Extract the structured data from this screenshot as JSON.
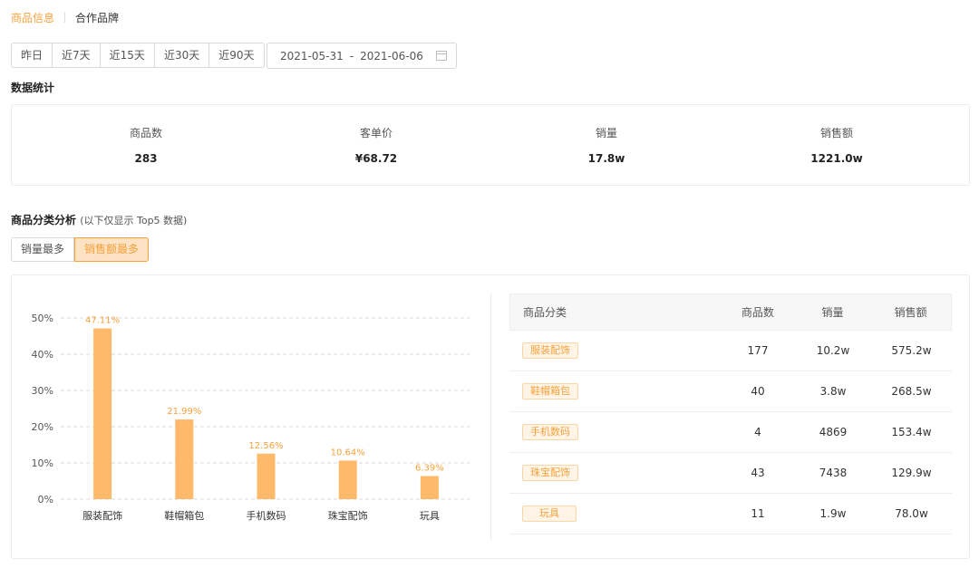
{
  "top_tabs": {
    "active": "商品信息",
    "inactive": "合作品牌"
  },
  "range_buttons": [
    "昨日",
    "近7天",
    "近15天",
    "近30天",
    "近90天"
  ],
  "date_range": {
    "start": "2021-05-31",
    "separator": "-",
    "end": "2021-06-06"
  },
  "stats_section": {
    "title": "数据统计",
    "items": [
      {
        "label": "商品数",
        "value": "283"
      },
      {
        "label": "客单价",
        "value": "¥68.72"
      },
      {
        "label": "销量",
        "value": "17.8w"
      },
      {
        "label": "销售额",
        "value": "1221.0w"
      }
    ]
  },
  "analysis_section": {
    "title": "商品分类分析",
    "note": "(以下仅显示 Top5 数据)",
    "toggle": [
      "销量最多",
      "销售额最多"
    ],
    "toggle_active": 1
  },
  "table": {
    "headers": [
      "商品分类",
      "商品数",
      "销量",
      "销售额"
    ],
    "rows": [
      {
        "category": "服装配饰",
        "count": "177",
        "sales": "10.2w",
        "revenue": "575.2w"
      },
      {
        "category": "鞋帽箱包",
        "count": "40",
        "sales": "3.8w",
        "revenue": "268.5w"
      },
      {
        "category": "手机数码",
        "count": "4",
        "sales": "4869",
        "revenue": "153.4w"
      },
      {
        "category": "珠宝配饰",
        "count": "43",
        "sales": "7438",
        "revenue": "129.9w"
      },
      {
        "category": "玩具",
        "count": "11",
        "sales": "1.9w",
        "revenue": "78.0w"
      }
    ]
  },
  "chart_data": {
    "type": "bar",
    "categories": [
      "服装配饰",
      "鞋帽箱包",
      "手机数码",
      "珠宝配饰",
      "玩具"
    ],
    "values": [
      47.11,
      21.99,
      12.56,
      10.64,
      6.39
    ],
    "value_labels": [
      "47.11%",
      "21.99%",
      "12.56%",
      "10.64%",
      "6.39%"
    ],
    "yticks": [
      "0%",
      "10%",
      "20%",
      "30%",
      "40%",
      "50%"
    ],
    "ylim": [
      0,
      50
    ],
    "grid": true,
    "colors": {
      "bar": "#ffb96b",
      "label": "#f5a13b",
      "grid": "#d9d9d9",
      "axis_text": "#555555"
    }
  }
}
